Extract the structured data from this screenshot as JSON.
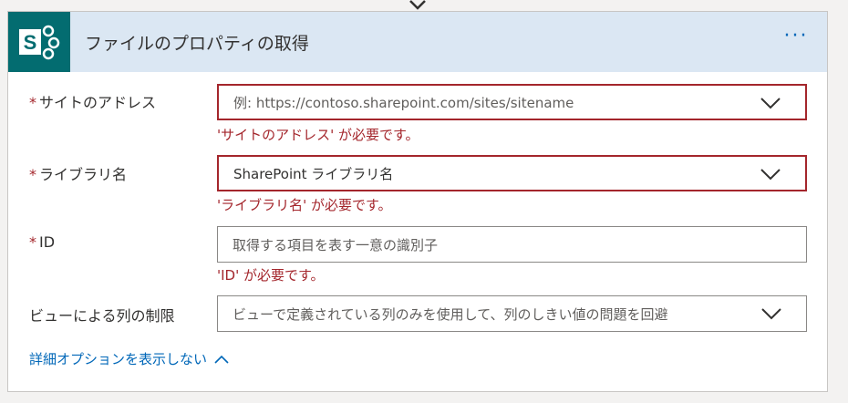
{
  "header": {
    "title": "ファイルのプロパティの取得",
    "more_label": "···",
    "icon": "sharepoint-icon",
    "accent": "#036c70",
    "header_bg": "#dbe7f3"
  },
  "fields": {
    "site_address": {
      "label": "サイトのアドレス",
      "required_mark": "*",
      "placeholder": "例: https://contoso.sharepoint.com/sites/sitename",
      "error": "'サイトのアドレス' が必要です。"
    },
    "library_name": {
      "label": "ライブラリ名",
      "required_mark": "*",
      "value": "SharePoint ライブラリ名",
      "error": "'ライブラリ名' が必要です。"
    },
    "id": {
      "label": "ID",
      "required_mark": "*",
      "placeholder": "取得する項目を表す一意の識別子",
      "error": "'ID' が必要です。"
    },
    "view_limit": {
      "label": "ビューによる列の制限",
      "placeholder": "ビューで定義されている列のみを使用して、列のしきい値の問題を回避"
    }
  },
  "advanced_link": {
    "label": "詳細オプションを表示しない"
  },
  "colors": {
    "error": "#a4262c",
    "link": "#0067b8"
  }
}
